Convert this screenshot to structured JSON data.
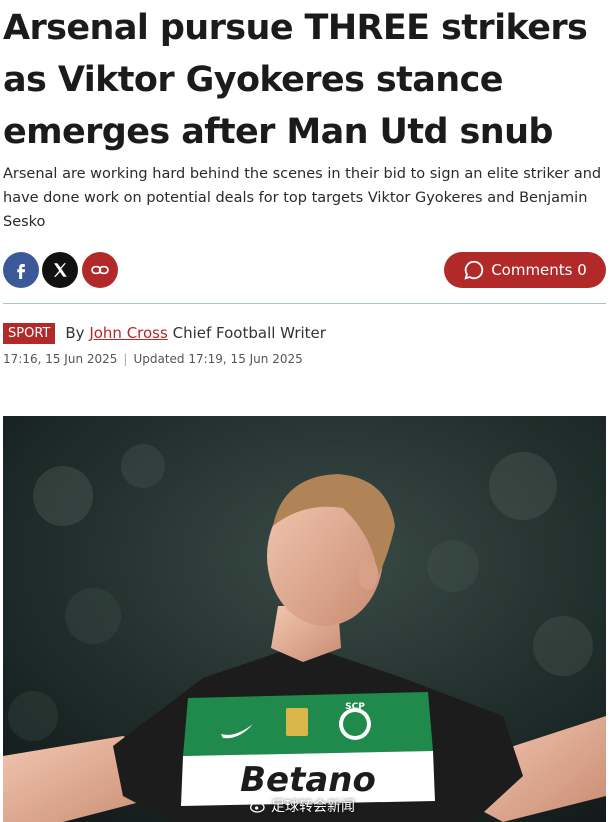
{
  "article": {
    "headline": "Arsenal pursue THREE strikers as Viktor Gyokeres stance emerges after Man Utd snub",
    "standfirst": "Arsenal are working hard behind the scenes in their bid to sign an elite striker and have done work on potential deals for top targets Viktor Gyokeres and Benjamin Sesko",
    "section_badge": "SPORT",
    "byline_prefix": "By",
    "author": "John Cross",
    "author_role": "Chief Football Writer",
    "published": "17:16, 15 Jun 2025",
    "updated": "Updated 17:19, 15 Jun 2025"
  },
  "share": {
    "icons": [
      "facebook-icon",
      "x-icon",
      "link-icon"
    ],
    "comments_label": "Comments 0"
  },
  "hero_image": {
    "shirt_sponsor": "Betano",
    "crest_text": "SCP",
    "watermark": "足球转会新闻"
  },
  "colors": {
    "accent": "#b22929",
    "facebook": "#3b5998",
    "x": "#111111",
    "divider": "#a9c7bf",
    "kit_green": "#1f8a4c"
  }
}
